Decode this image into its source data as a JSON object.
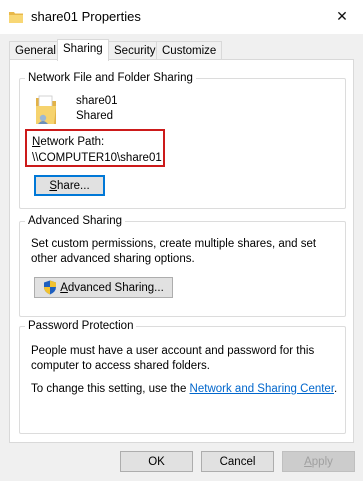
{
  "window": {
    "title": "share01 Properties",
    "close_glyph": "✕"
  },
  "tabs": [
    {
      "label": "General"
    },
    {
      "label": "Sharing"
    },
    {
      "label": "Security"
    },
    {
      "label": "Customize"
    }
  ],
  "network_sharing": {
    "legend": "Network File and Folder Sharing",
    "folder_name": "share01",
    "folder_status": "Shared",
    "path_label_first": "N",
    "path_label_rest": "etwork Path:",
    "path_value": "\\\\COMPUTER10\\share01",
    "share_button_first": "S",
    "share_button_rest": "hare..."
  },
  "advanced_sharing": {
    "legend": "Advanced Sharing",
    "description": "Set custom permissions, create multiple shares, and set other advanced sharing options.",
    "button_first": "A",
    "button_rest": "dvanced Sharing..."
  },
  "password_protection": {
    "legend": "Password Protection",
    "description": "People must have a user account and password for this computer to access shared folders.",
    "change_text": "To change this setting, use the ",
    "link_text": "Network and Sharing Center",
    "change_suffix": "."
  },
  "footer": {
    "ok_label": "OK",
    "cancel_label": "Cancel",
    "apply_first": "A",
    "apply_rest": "pply"
  },
  "colors": {
    "highlight_border": "#cc1a1a",
    "link": "#0066cc",
    "focus": "#0078d7"
  },
  "icons": {
    "title": "folder-icon",
    "folder": "shared-folder-icon",
    "shield": "uac-shield-icon"
  }
}
